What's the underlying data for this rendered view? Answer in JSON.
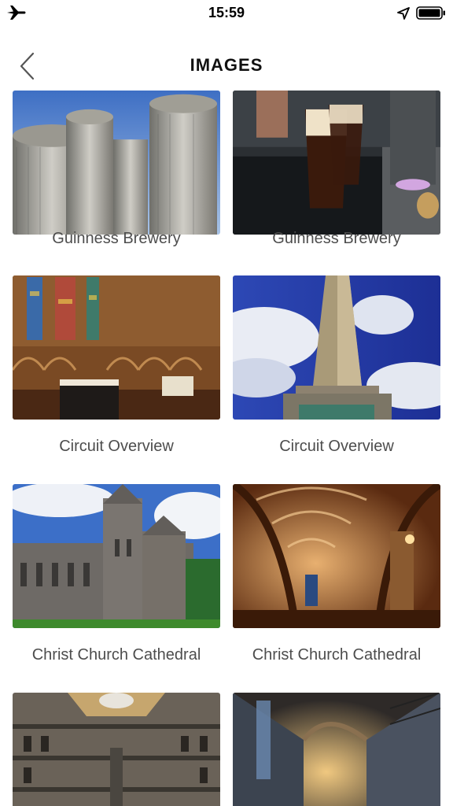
{
  "status_bar": {
    "time": "15:59",
    "icons": [
      "airplane-icon",
      "location-arrow-icon",
      "battery-icon"
    ]
  },
  "header": {
    "title": "IMAGES",
    "back_icon": "chevron-left-icon"
  },
  "gallery": {
    "items": [
      {
        "caption": "Guinness Brewery",
        "image": "brewery-silos-photo"
      },
      {
        "caption": "Guinness Brewery",
        "image": "guinness-pints-photo"
      },
      {
        "caption": "Circuit Overview",
        "image": "church-interior-photo"
      },
      {
        "caption": "Circuit Overview",
        "image": "obelisk-monument-photo"
      },
      {
        "caption": "Christ Church Cathedral",
        "image": "cathedral-exterior-photo"
      },
      {
        "caption": "Christ Church Cathedral",
        "image": "cathedral-nave-photo"
      },
      {
        "caption": "",
        "image": "prison-hall-photo"
      },
      {
        "caption": "",
        "image": "prison-corridor-photo"
      }
    ]
  }
}
